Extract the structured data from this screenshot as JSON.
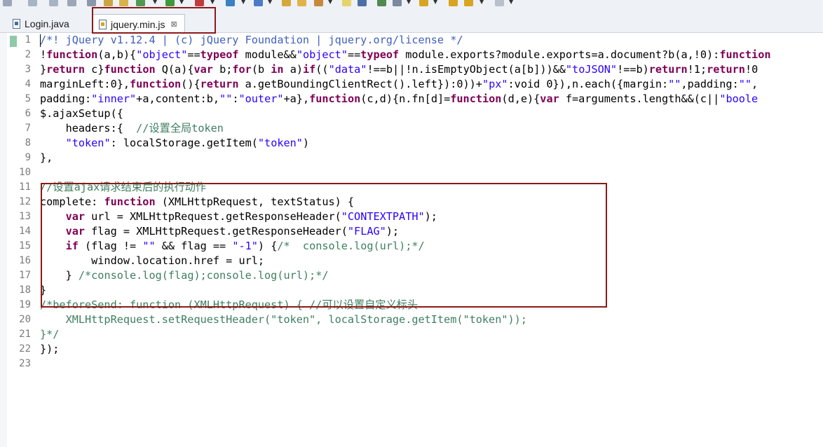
{
  "tabs": [
    {
      "label": "Login.java",
      "icon": "java-file-icon"
    },
    {
      "label": "jquery.min.js",
      "icon": "js-file-icon",
      "active": true
    }
  ],
  "line_numbers": [
    "1",
    "2",
    "3",
    "4",
    "5",
    "6",
    "7",
    "8",
    "9",
    "10",
    "11",
    "12",
    "13",
    "14",
    "15",
    "16",
    "17",
    "18",
    "19",
    "20",
    "21",
    "22",
    "23"
  ],
  "code": {
    "l1": "/*! jQuery v1.12.4 | (c) jQuery Foundation | jquery.org/license */",
    "l2": [
      "!",
      "function",
      "(a,b){",
      "\"object\"",
      "==",
      "typeof",
      " module&&",
      "\"object\"",
      "==",
      "typeof",
      " module.exports?module.exports=a.document?b(a,!0):",
      "function"
    ],
    "l3": [
      "}",
      "return",
      " c}",
      "function",
      " Q(a){",
      "var",
      " b;",
      "for",
      "(b ",
      "in",
      " a)",
      "if",
      "((",
      "\"data\"",
      "!==b||!n.isEmptyObject(a[b]))&&",
      "\"toJSON\"",
      "!==b)",
      "return",
      "!1;",
      "return",
      "!0"
    ],
    "l4": [
      "marginLeft:0},",
      "function",
      "(){",
      "return",
      " a.getBoundingClientRect().left}):0))+",
      "\"px\"",
      ":void 0}),n.each({margin:",
      "\"\"",
      ",padding:",
      "\"\"",
      ","
    ],
    "l5": [
      "padding:",
      "\"inner\"",
      "+a,content:b,",
      "\"\"",
      ":",
      "\"outer\"",
      "+a},",
      "function",
      "(c,d){n.fn[d]=",
      "function",
      "(d,e){",
      "var",
      " f=arguments.length&&(c||",
      "\"boole"
    ],
    "l6": "$.ajaxSetup({",
    "l7": [
      "    headers:{  ",
      "//设置全局token"
    ],
    "l8": [
      "    ",
      "\"token\"",
      ": localStorage.getItem(",
      "\"token\"",
      ")"
    ],
    "l9": "},",
    "l10": "",
    "l11": "//设置ajax请求结束后的执行动作",
    "l12": [
      "complete: ",
      "function",
      " (XMLHttpRequest, textStatus) {"
    ],
    "l13": [
      "    ",
      "var",
      " url = XMLHttpRequest.getResponseHeader(",
      "\"CONTEXTPATH\"",
      ");"
    ],
    "l14": [
      "    ",
      "var",
      " flag = XMLHttpRequest.getResponseHeader(",
      "\"FLAG\"",
      ");"
    ],
    "l15": [
      "    ",
      "if",
      " (flag != ",
      "\"\"",
      " && flag == ",
      "\"-1\"",
      ") {",
      "/*  console.log(url);*/"
    ],
    "l16": "        window.location.href = url;",
    "l17": [
      "    } ",
      "/*console.log(flag);console.log(url);*/"
    ],
    "l18": "}",
    "l19": "/*beforeSend: function (XMLHttpRequest) { //可以设置自定义标头",
    "l20": "    XMLHttpRequest.setRequestHeader(\"token\", localStorage.getItem(\"token\"));",
    "l21": "}*/",
    "l22": "});",
    "l23": ""
  },
  "colors": {
    "keyword": "#7f0055",
    "string": "#2a00ff",
    "comment": "#3f7f5f",
    "annotation_box": "#8b1a1a"
  }
}
